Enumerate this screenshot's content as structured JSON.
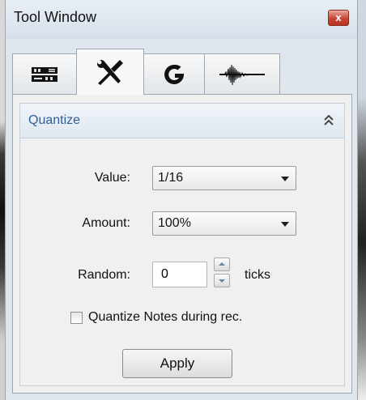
{
  "window": {
    "title": "Tool Window",
    "close_label": "x"
  },
  "tabs": [
    {
      "name": "mixer",
      "icon": "hardware-rack-icon",
      "active": false
    },
    {
      "name": "tools",
      "icon": "tools-crossed-icon",
      "active": true
    },
    {
      "name": "groove",
      "icon": "g-swirl-icon",
      "active": false
    },
    {
      "name": "audio",
      "icon": "waveform-icon",
      "active": false
    }
  ],
  "quantize": {
    "title": "Quantize",
    "value_label": "Value:",
    "value": "1/16",
    "amount_label": "Amount:",
    "amount": "100%",
    "random_label": "Random:",
    "random_value": "0",
    "random_unit": "ticks",
    "checkbox_label": "Quantize Notes during rec.",
    "checkbox_checked": false,
    "apply_label": "Apply"
  },
  "colors": {
    "accent_text": "#2f5f96",
    "close_button": "#c84534"
  }
}
